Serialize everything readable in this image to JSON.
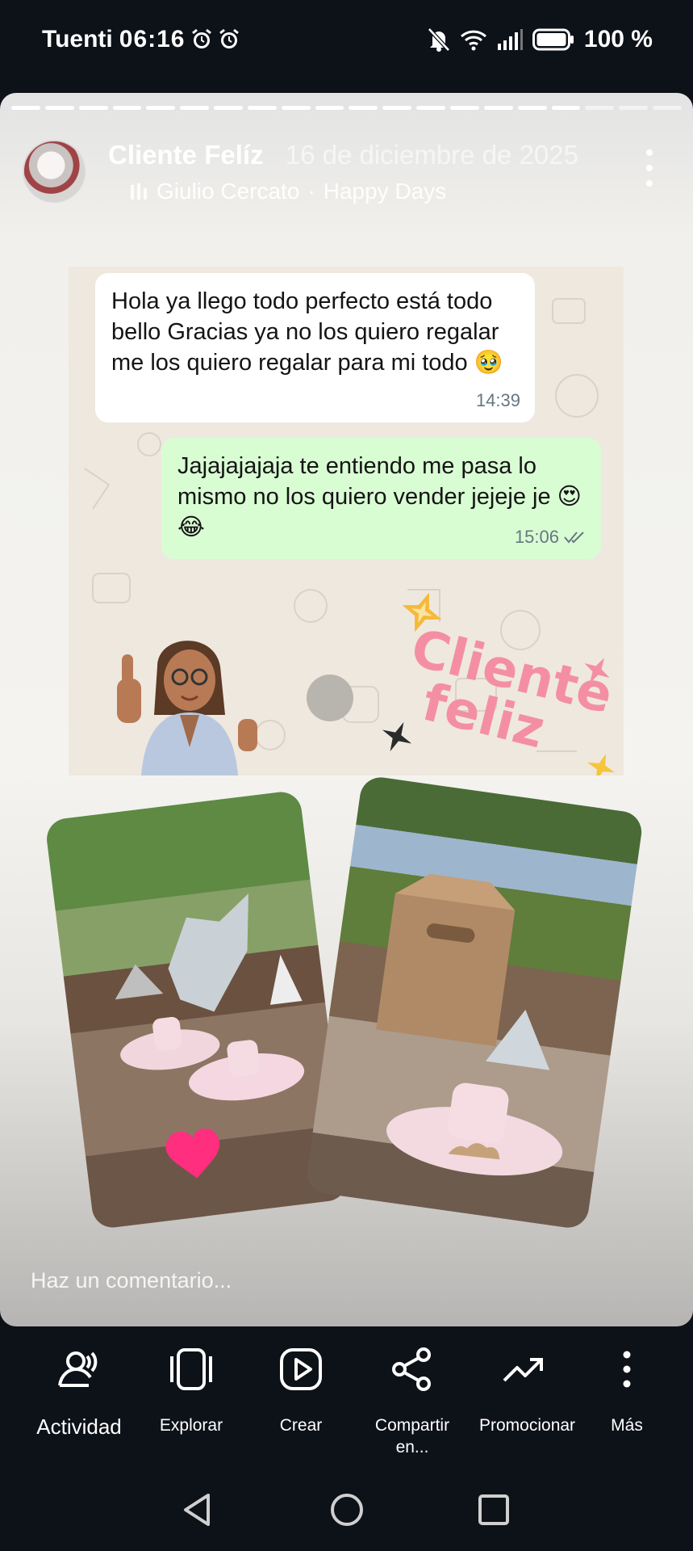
{
  "status_bar": {
    "carrier": "Tuenti",
    "time": "06:16",
    "battery": "100 %",
    "icons": [
      "alarm-icon",
      "alarm-icon",
      "mute-icon",
      "wifi-icon",
      "signal-icon",
      "battery-icon"
    ]
  },
  "story": {
    "progress_segments_filled": 17,
    "progress_segments_total": 20,
    "author": "Cliente Felíz",
    "date": "16 de diciembre de 2025",
    "music": {
      "artist": "Giulio Cercato",
      "separator": "·",
      "song": "Happy Days"
    },
    "chat": {
      "incoming": {
        "text": "Hola ya llego todo perfecto está todo bello Gracias ya no los quiero regalar me los quiero regalar para mi todo 🥹",
        "time": "14:39"
      },
      "outgoing": {
        "text": "Jajajajajaja te entiendo me pasa lo mismo no los quiero vender jejeje je 😍😂",
        "time": "15:06"
      }
    },
    "sticker": {
      "line1": "Cliente",
      "line2": "feliz"
    },
    "comment_placeholder": "Haz un comentario..."
  },
  "actions": [
    {
      "label": "Actividad",
      "icon": "activity-icon"
    },
    {
      "label": "Explorar",
      "icon": "explore-icon"
    },
    {
      "label": "Crear",
      "icon": "play-icon"
    },
    {
      "label": "Compartir en...",
      "icon": "share-icon"
    },
    {
      "label": "Promocionar",
      "icon": "trending-up-icon"
    },
    {
      "label": "Más",
      "icon": "more-vertical-icon"
    }
  ],
  "colors": {
    "background": "#0d1118",
    "bubble_in": "#ffffff",
    "bubble_out": "#d9fdd3",
    "sticker_pink": "#f48fa3",
    "heart": "#ff2e7e"
  }
}
